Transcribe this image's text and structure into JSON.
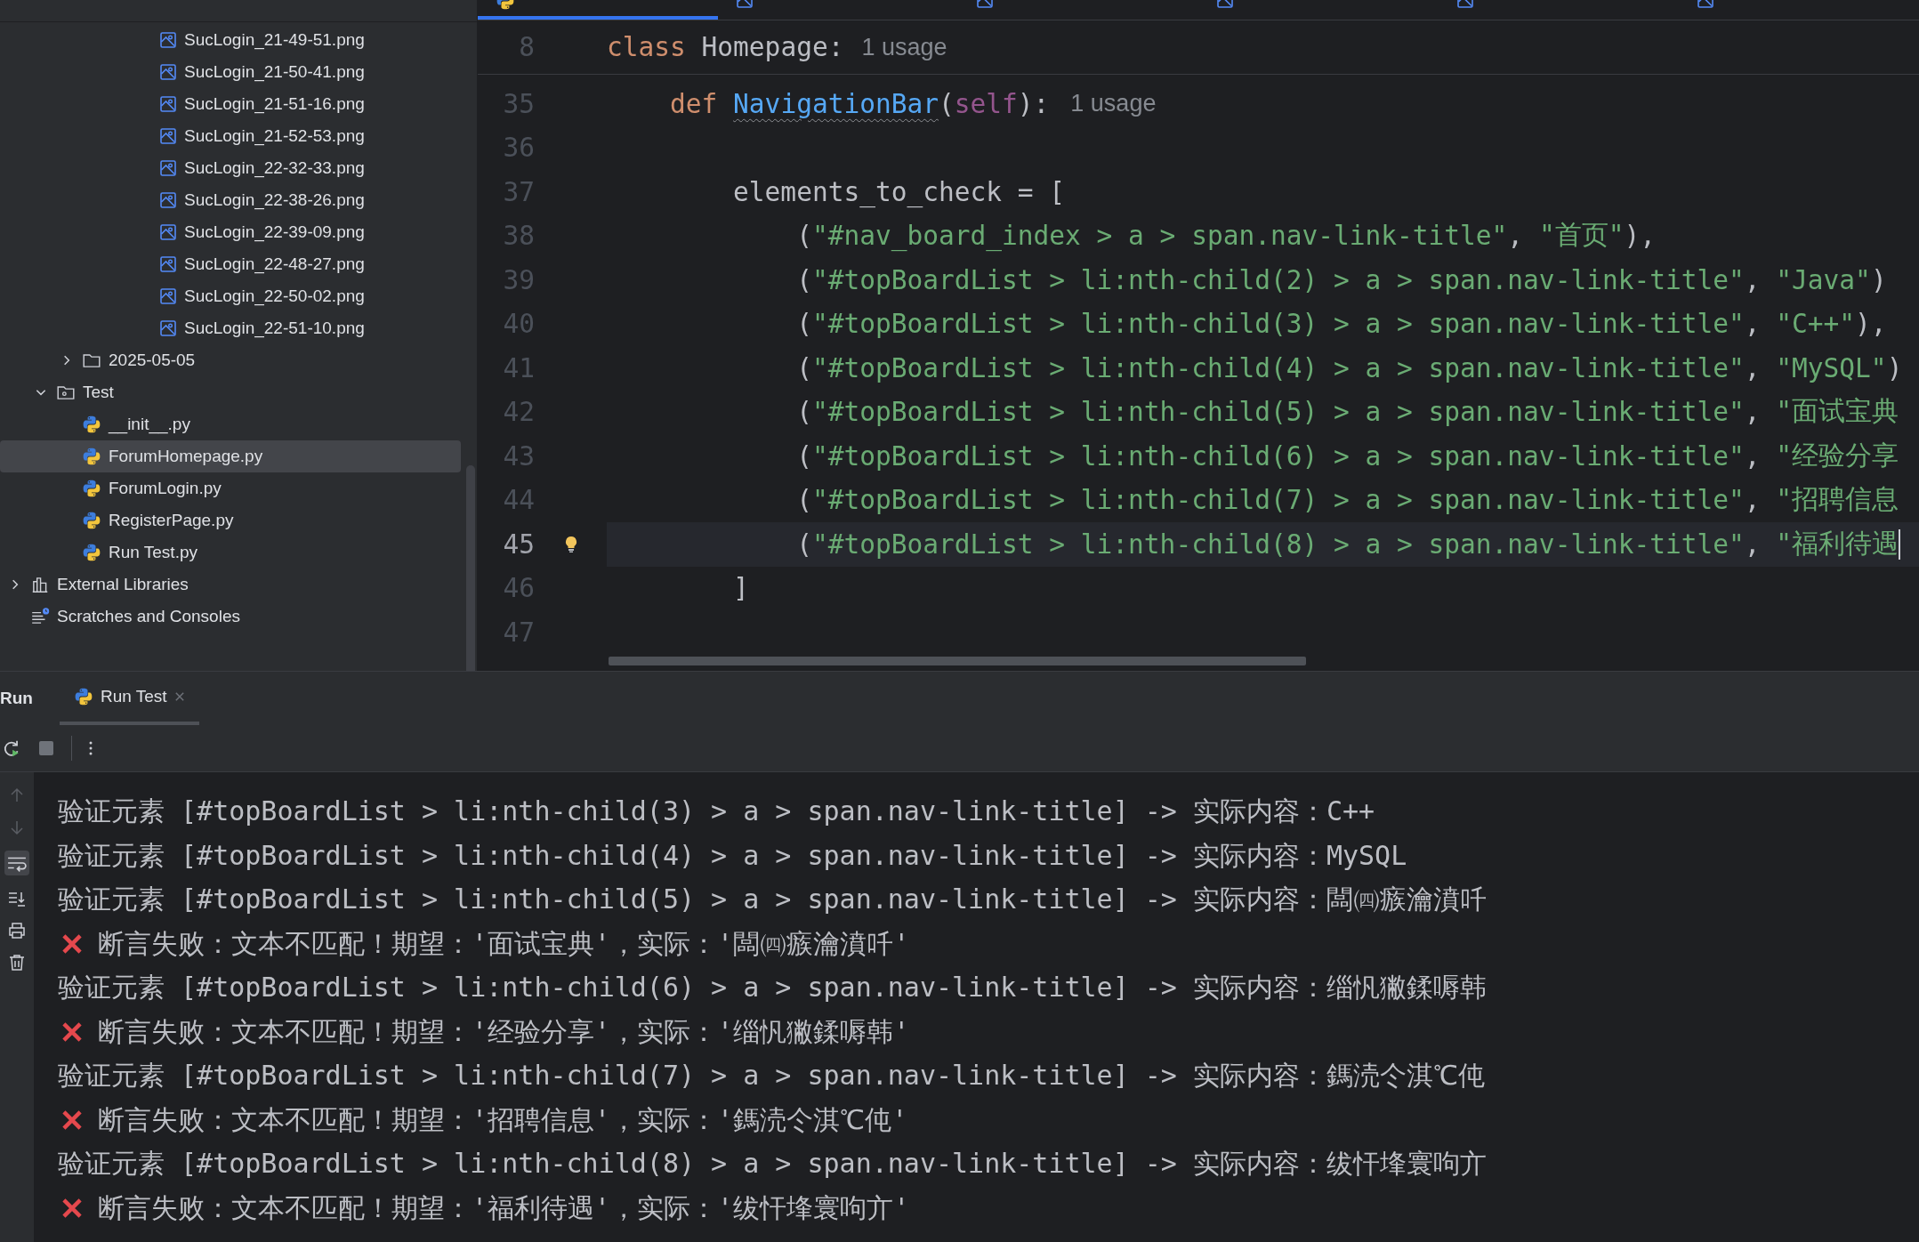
{
  "project_panel": {
    "tree": [
      {
        "children": [
          {
            "children": [
              {
                "children": [
                  {
                    "children": [
                      {
                        "children": [
                          {
                            "label": "SucLogin_21-49-51.png",
                            "kind": "image",
                            "selected": false
                          },
                          {
                            "label": "SucLogin_21-50-41.png",
                            "kind": "image",
                            "selected": false
                          },
                          {
                            "label": "SucLogin_21-51-16.png",
                            "kind": "image",
                            "selected": false
                          },
                          {
                            "label": "SucLogin_21-52-53.png",
                            "kind": "image",
                            "selected": false
                          },
                          {
                            "label": "SucLogin_22-32-33.png",
                            "kind": "image",
                            "selected": false
                          },
                          {
                            "label": "SucLogin_22-38-26.png",
                            "kind": "image",
                            "selected": false
                          },
                          {
                            "label": "SucLogin_22-39-09.png",
                            "kind": "image",
                            "selected": false
                          },
                          {
                            "label": "SucLogin_22-48-27.png",
                            "kind": "image",
                            "selected": false
                          },
                          {
                            "label": "SucLogin_22-50-02.png",
                            "kind": "image",
                            "selected": false
                          },
                          {
                            "label": "SucLogin_22-51-10.png",
                            "kind": "image",
                            "selected": false
                          }
                        ]
                      }
                    ]
                  }
                ]
              },
              {
                "label": "2025-05-05",
                "kind": "folder",
                "expanded": false,
                "selected": false
              }
            ]
          },
          {
            "label": "Test",
            "kind": "package",
            "expanded": true,
            "selected": false,
            "children": [
              {
                "label": "__init__.py",
                "kind": "python",
                "selected": false
              },
              {
                "label": "ForumHomepage.py",
                "kind": "python",
                "selected": true
              },
              {
                "label": "ForumLogin.py",
                "kind": "python",
                "selected": false
              },
              {
                "label": "RegisterPage.py",
                "kind": "python",
                "selected": false
              },
              {
                "label": "Run Test.py",
                "kind": "python",
                "selected": false
              }
            ]
          }
        ]
      },
      {
        "label": "External Libraries",
        "kind": "libraries",
        "expanded": false,
        "selected": false
      },
      {
        "label": "Scratches and Consoles",
        "kind": "scratches",
        "selected": false
      }
    ]
  },
  "editor": {
    "tabs": [
      {
        "kind": "python",
        "selected": true
      },
      {
        "kind": "image",
        "selected": false
      },
      {
        "kind": "image",
        "selected": false
      },
      {
        "kind": "image",
        "selected": false
      },
      {
        "kind": "image",
        "selected": false
      },
      {
        "kind": "image",
        "selected": false
      }
    ],
    "sticky_line": {
      "number": "8",
      "tokens": [
        {
          "kind": "keyword",
          "text": "class "
        },
        {
          "kind": "plain",
          "text": "Homepage:"
        }
      ],
      "hint": "1 usage"
    },
    "lines": [
      {
        "number": "35",
        "current": false,
        "bulb": false,
        "tokens": [
          {
            "kind": "keyword",
            "text": "    def "
          },
          {
            "kind": "function",
            "text": "NavigationBar"
          },
          {
            "kind": "punct",
            "text": "("
          },
          {
            "kind": "self",
            "text": "self"
          },
          {
            "kind": "punct",
            "text": "):"
          }
        ],
        "hint": "1 usage"
      },
      {
        "number": "36",
        "current": false,
        "bulb": false
      },
      {
        "number": "37",
        "current": false,
        "bulb": false,
        "tokens": [
          {
            "kind": "plain",
            "text": "        elements_to_check = ["
          }
        ]
      },
      {
        "number": "38",
        "current": false,
        "bulb": false,
        "tokens": [
          {
            "kind": "punct",
            "text": "            ("
          },
          {
            "kind": "string",
            "text": "\"#nav_board_index > a > span.nav-link-title\""
          },
          {
            "kind": "punct",
            "text": ", "
          },
          {
            "kind": "string",
            "text": "\"首页\""
          },
          {
            "kind": "punct",
            "text": "),"
          }
        ]
      },
      {
        "number": "39",
        "current": false,
        "bulb": false,
        "tokens": [
          {
            "kind": "punct",
            "text": "            ("
          },
          {
            "kind": "string",
            "text": "\"#topBoardList > li:nth-child(2) > a > span.nav-link-title\""
          },
          {
            "kind": "punct",
            "text": ", "
          },
          {
            "kind": "string",
            "text": "\"Java\""
          },
          {
            "kind": "punct",
            "text": ")"
          }
        ]
      },
      {
        "number": "40",
        "current": false,
        "bulb": false,
        "tokens": [
          {
            "kind": "punct",
            "text": "            ("
          },
          {
            "kind": "string",
            "text": "\"#topBoardList > li:nth-child(3) > a > span.nav-link-title\""
          },
          {
            "kind": "punct",
            "text": ", "
          },
          {
            "kind": "string",
            "text": "\"C++\""
          },
          {
            "kind": "punct",
            "text": "),"
          }
        ]
      },
      {
        "number": "41",
        "current": false,
        "bulb": false,
        "tokens": [
          {
            "kind": "punct",
            "text": "            ("
          },
          {
            "kind": "string",
            "text": "\"#topBoardList > li:nth-child(4) > a > span.nav-link-title\""
          },
          {
            "kind": "punct",
            "text": ", "
          },
          {
            "kind": "string",
            "text": "\"MySQL\""
          },
          {
            "kind": "punct",
            "text": ")"
          }
        ]
      },
      {
        "number": "42",
        "current": false,
        "bulb": false,
        "tokens": [
          {
            "kind": "punct",
            "text": "            ("
          },
          {
            "kind": "string",
            "text": "\"#topBoardList > li:nth-child(5) > a > span.nav-link-title\""
          },
          {
            "kind": "punct",
            "text": ", "
          },
          {
            "kind": "string",
            "text": "\"面试宝典"
          }
        ]
      },
      {
        "number": "43",
        "current": false,
        "bulb": false,
        "tokens": [
          {
            "kind": "punct",
            "text": "            ("
          },
          {
            "kind": "string",
            "text": "\"#topBoardList > li:nth-child(6) > a > span.nav-link-title\""
          },
          {
            "kind": "punct",
            "text": ", "
          },
          {
            "kind": "string",
            "text": "\"经验分享"
          }
        ]
      },
      {
        "number": "44",
        "current": false,
        "bulb": false,
        "tokens": [
          {
            "kind": "punct",
            "text": "            ("
          },
          {
            "kind": "string",
            "text": "\"#topBoardList > li:nth-child(7) > a > span.nav-link-title\""
          },
          {
            "kind": "punct",
            "text": ", "
          },
          {
            "kind": "string",
            "text": "\"招聘信息"
          }
        ]
      },
      {
        "number": "45",
        "current": true,
        "bulb": true,
        "tokens": [
          {
            "kind": "punct",
            "text": "            ("
          },
          {
            "kind": "string",
            "text": "\"#topBoardList > li:nth-child(8) > a > span.nav-link-title\""
          },
          {
            "kind": "punct",
            "text": ", "
          },
          {
            "kind": "string",
            "text": "\"福利待遇"
          }
        ]
      },
      {
        "number": "46",
        "current": false,
        "bulb": false,
        "tokens": [
          {
            "kind": "punct",
            "text": "        ]"
          }
        ]
      },
      {
        "number": "47",
        "current": false,
        "bulb": false
      }
    ]
  },
  "run_panel": {
    "title": "Run",
    "tabs": [
      {
        "label": "Run Test",
        "selected": true
      }
    ],
    "console": [
      {
        "kind": "info",
        "text": "验证元素 [#topBoardList > li:nth-child(3) > a > span.nav-link-title] -> 实际内容：C++"
      },
      {
        "kind": "info",
        "text": "验证元素 [#topBoardList > li:nth-child(4) > a > span.nav-link-title] -> 实际内容：MySQL"
      },
      {
        "kind": "info",
        "text": "验证元素 [#topBoardList > li:nth-child(5) > a > span.nav-link-title] -> 实际内容：闆㈣瘯瀹濆吀"
      },
      {
        "kind": "error",
        "text": "断言失败：文本不匹配！期望：'面试宝典'，实际：'闆㈣瘯瀹濆吀'"
      },
      {
        "kind": "info",
        "text": "验证元素 [#topBoardList > li:nth-child(6) > a > span.nav-link-title] -> 实际内容：缁忛獙鍒嗕韩"
      },
      {
        "kind": "error",
        "text": "断言失败：文本不匹配！期望：'经验分享'，实际：'缁忛獙鍒嗕韩'"
      },
      {
        "kind": "info",
        "text": "验证元素 [#topBoardList > li:nth-child(7) > a > span.nav-link-title] -> 实际内容：鎷涜仒淇℃伅"
      },
      {
        "kind": "error",
        "text": "断言失败：文本不匹配！期望：'招聘信息'，实际：'鎷涜仒淇℃伅'"
      },
      {
        "kind": "info",
        "text": "验证元素 [#topBoardList > li:nth-child(8) > a > span.nav-link-title] -> 实际内容：绂忓埄寰呴亣"
      },
      {
        "kind": "error",
        "text": "断言失败：文本不匹配！期望：'福利待遇'，实际：'绂忓埄寰呴亣'"
      }
    ]
  }
}
